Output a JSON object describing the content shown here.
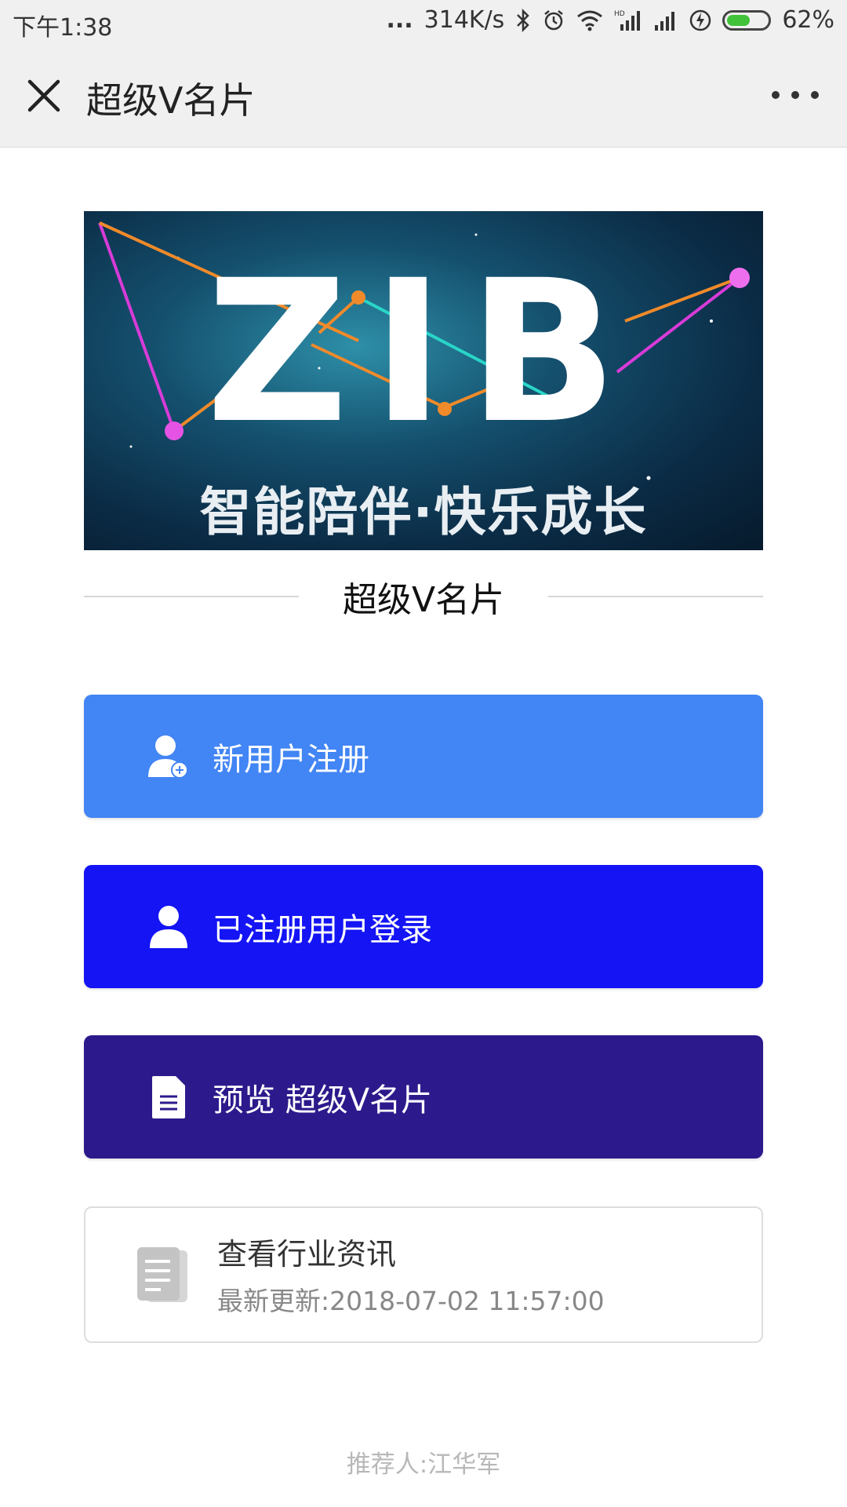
{
  "status_bar": {
    "time": "下午1:38",
    "dots": "...",
    "speed": "314K/s",
    "battery_percent": "62%",
    "battery_level": 0.62
  },
  "title_bar": {
    "title": "超级V名片"
  },
  "banner": {
    "logo_text": "ZIB",
    "slogan": "智能陪伴·快乐成长"
  },
  "section": {
    "title": "超级V名片"
  },
  "actions": {
    "register_label": "新用户注册",
    "login_label": "已注册用户登录",
    "preview_label": "预览 超级V名片"
  },
  "news": {
    "title": "查看行业资讯",
    "updated": "最新更新:2018-07-02 11:57:00"
  },
  "footer": {
    "referrer": "推荐人:江华军"
  },
  "colors": {
    "register": "#4285f4",
    "login": "#1414f5",
    "preview": "#2c1a8c"
  }
}
